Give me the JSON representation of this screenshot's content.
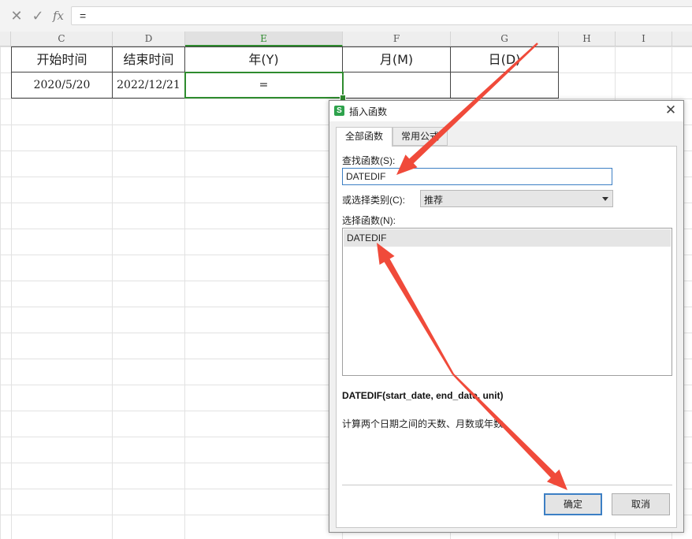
{
  "formula_bar": {
    "cancel_icon": "close-icon",
    "confirm_icon": "check-icon",
    "fx_label": "fx",
    "value": "="
  },
  "columns": [
    "C",
    "D",
    "E",
    "F",
    "G",
    "H",
    "I"
  ],
  "selected_column": "E",
  "table": {
    "headers": [
      "开始时间",
      "结束时间",
      "年(Y)",
      "月(M)",
      "日(D)"
    ],
    "row": [
      "2020/5/20",
      "2022/12/21",
      "=",
      "",
      ""
    ]
  },
  "dialog": {
    "title": "插入函数",
    "app_icon_letter": "S",
    "tabs": [
      "全部函数",
      "常用公式"
    ],
    "search_label": "查找函数(S):",
    "search_value": "DATEDIF",
    "category_label": "或选择类别(C):",
    "category_value": "推荐",
    "list_label": "选择函数(N):",
    "functions": [
      "DATEDIF"
    ],
    "signature": "DATEDIF(start_date, end_date, unit)",
    "description": "计算两个日期之间的天数、月数或年数。",
    "ok_label": "确定",
    "cancel_label": "取消"
  },
  "annotation_color": "#f04a3a"
}
